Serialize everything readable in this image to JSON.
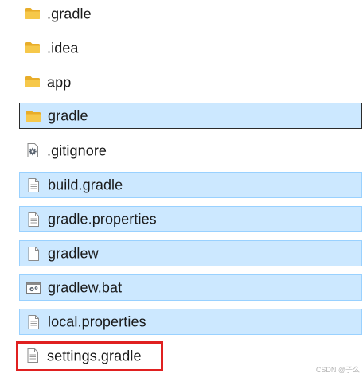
{
  "files": [
    {
      "name": ".gradle",
      "icon": "folder-icon",
      "selected": false,
      "focused": false
    },
    {
      "name": ".idea",
      "icon": "folder-icon",
      "selected": false,
      "focused": false
    },
    {
      "name": "app",
      "icon": "folder-icon",
      "selected": false,
      "focused": false
    },
    {
      "name": "gradle",
      "icon": "folder-icon",
      "selected": true,
      "focused": true
    },
    {
      "name": ".gitignore",
      "icon": "settings-file-icon",
      "selected": false,
      "focused": false
    },
    {
      "name": "build.gradle",
      "icon": "document-icon",
      "selected": true,
      "focused": false
    },
    {
      "name": "gradle.properties",
      "icon": "document-icon",
      "selected": true,
      "focused": false
    },
    {
      "name": "gradlew",
      "icon": "blank-file-icon",
      "selected": true,
      "focused": false
    },
    {
      "name": "gradlew.bat",
      "icon": "batch-file-icon",
      "selected": true,
      "focused": false
    },
    {
      "name": "local.properties",
      "icon": "document-icon",
      "selected": true,
      "focused": false
    },
    {
      "name": "settings.gradle",
      "icon": "document-icon",
      "selected": false,
      "focused": false
    }
  ],
  "highlighted_file": "settings.gradle",
  "colors": {
    "selection_fill": "#cce8ff",
    "selection_border": "#99d1ff",
    "highlight_border": "#e02020",
    "folder": "#f4c03f"
  },
  "watermark": "CSDN @子么"
}
